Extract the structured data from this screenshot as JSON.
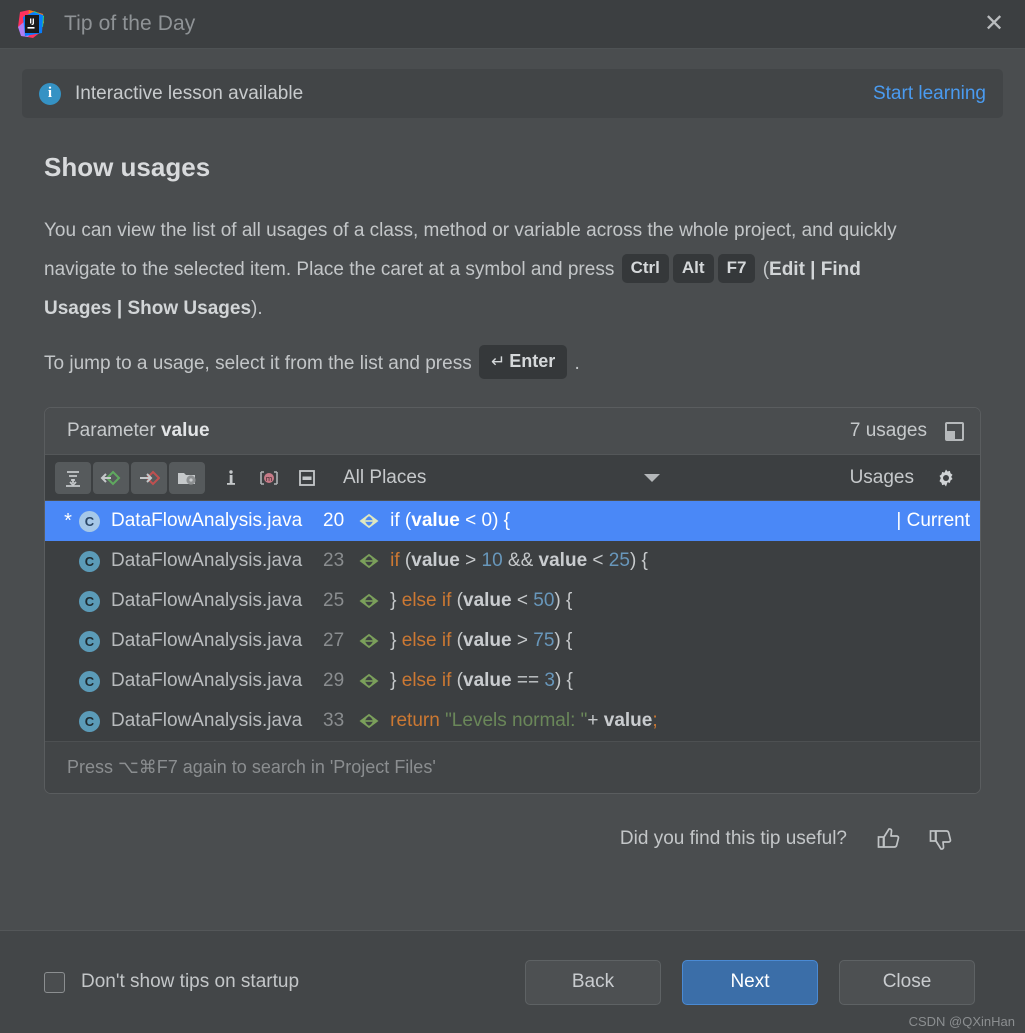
{
  "window": {
    "title": "Tip of the Day",
    "app_icon": "intellij-idea-logo",
    "close_icon": "close-icon"
  },
  "banner": {
    "icon": "info-icon",
    "text": "Interactive lesson available",
    "link": "Start learning"
  },
  "tip": {
    "title": "Show usages",
    "paragraph1_part1": "You can view the list of all usages of a class, method or variable across the whole project, and quickly navigate to the selected item. Place the caret at a symbol and press ",
    "keys": [
      "Ctrl",
      "Alt",
      "F7"
    ],
    "paragraph1_part2_open": "(",
    "paragraph1_menu": "Edit | Find Usages | Show Usages",
    "paragraph1_part2_close": ").",
    "paragraph2_part1": "To jump to a usage, select it from the list and press",
    "enter_key_symbol": "↵",
    "enter_key_label": "Enter",
    "paragraph2_part2": "."
  },
  "usages": {
    "header": {
      "label_prefix": "Parameter",
      "label_symbol": "value",
      "count": "7 usages",
      "pin_icon": "pin-window-icon"
    },
    "toolbar": {
      "buttons": [
        {
          "name": "expand-all-icon",
          "framed": true
        },
        {
          "name": "previous-occurrence-icon",
          "framed": true
        },
        {
          "name": "next-occurrence-icon",
          "framed": true
        },
        {
          "name": "settings-folder-icon",
          "framed": true
        },
        {
          "name": "info-details-icon",
          "framed": false
        },
        {
          "name": "merge-duplicates-icon",
          "framed": false
        },
        {
          "name": "preview-panel-icon",
          "framed": false
        }
      ],
      "scope_label": "All Places",
      "scope_caret_icon": "chevron-down-icon",
      "right_label": "Usages",
      "gear_icon": "gear-icon"
    },
    "rows": [
      {
        "star": "*",
        "file": "DataFlowAnalysis.java",
        "line": "20",
        "selected": true,
        "tag": "| Current",
        "code": [
          {
            "t": "if (",
            "c": "plain"
          },
          {
            "t": "value",
            "c": "vb"
          },
          {
            "t": " < ",
            "c": "plain"
          },
          {
            "t": "0",
            "c": "num"
          },
          {
            "t": ") {",
            "c": "plain"
          }
        ]
      },
      {
        "star": "",
        "file": "DataFlowAnalysis.java",
        "line": "23",
        "selected": false,
        "tag": "",
        "code": [
          {
            "t": "if",
            "c": "kw"
          },
          {
            "t": " (",
            "c": "plain"
          },
          {
            "t": "value",
            "c": "vb"
          },
          {
            "t": " > ",
            "c": "plain"
          },
          {
            "t": "10",
            "c": "num"
          },
          {
            "t": " && ",
            "c": "plain"
          },
          {
            "t": "value",
            "c": "vb"
          },
          {
            "t": " < ",
            "c": "plain"
          },
          {
            "t": "25",
            "c": "num"
          },
          {
            "t": ") {",
            "c": "plain"
          }
        ]
      },
      {
        "star": "",
        "file": "DataFlowAnalysis.java",
        "line": "25",
        "selected": false,
        "tag": "",
        "code": [
          {
            "t": "} ",
            "c": "plain"
          },
          {
            "t": "else if",
            "c": "kw"
          },
          {
            "t": " (",
            "c": "plain"
          },
          {
            "t": "value",
            "c": "vb"
          },
          {
            "t": " < ",
            "c": "plain"
          },
          {
            "t": "50",
            "c": "num"
          },
          {
            "t": ") {",
            "c": "plain"
          }
        ]
      },
      {
        "star": "",
        "file": "DataFlowAnalysis.java",
        "line": "27",
        "selected": false,
        "tag": "",
        "code": [
          {
            "t": "} ",
            "c": "plain"
          },
          {
            "t": "else if",
            "c": "kw"
          },
          {
            "t": " (",
            "c": "plain"
          },
          {
            "t": "value",
            "c": "vb"
          },
          {
            "t": " > ",
            "c": "plain"
          },
          {
            "t": "75",
            "c": "num"
          },
          {
            "t": ") {",
            "c": "plain"
          }
        ]
      },
      {
        "star": "",
        "file": "DataFlowAnalysis.java",
        "line": "29",
        "selected": false,
        "tag": "",
        "code": [
          {
            "t": "} ",
            "c": "plain"
          },
          {
            "t": "else if",
            "c": "kw"
          },
          {
            "t": " (",
            "c": "plain"
          },
          {
            "t": "value",
            "c": "vb"
          },
          {
            "t": " == ",
            "c": "plain"
          },
          {
            "t": "3",
            "c": "num"
          },
          {
            "t": ") {",
            "c": "plain"
          }
        ]
      },
      {
        "star": "",
        "file": "DataFlowAnalysis.java",
        "line": "33",
        "selected": false,
        "tag": "",
        "code": [
          {
            "t": "return",
            "c": "kw"
          },
          {
            "t": " ",
            "c": "plain"
          },
          {
            "t": "\"Levels normal: \"",
            "c": "str"
          },
          {
            "t": "+ ",
            "c": "plain"
          },
          {
            "t": "value",
            "c": "vb"
          },
          {
            "t": ";",
            "c": "kw"
          }
        ]
      }
    ],
    "footer_text": "Press ⌥⌘F7 again to search in 'Project Files'"
  },
  "feedback": {
    "question": "Did you find this tip useful?",
    "thumbs_up_icon": "thumbs-up-icon",
    "thumbs_down_icon": "thumbs-down-icon"
  },
  "footer": {
    "checkbox_label": "Don't show tips on startup",
    "checkbox_checked": false,
    "back_label": "Back",
    "next_label": "Next",
    "close_label": "Close"
  },
  "watermark": "CSDN @QXinHan"
}
